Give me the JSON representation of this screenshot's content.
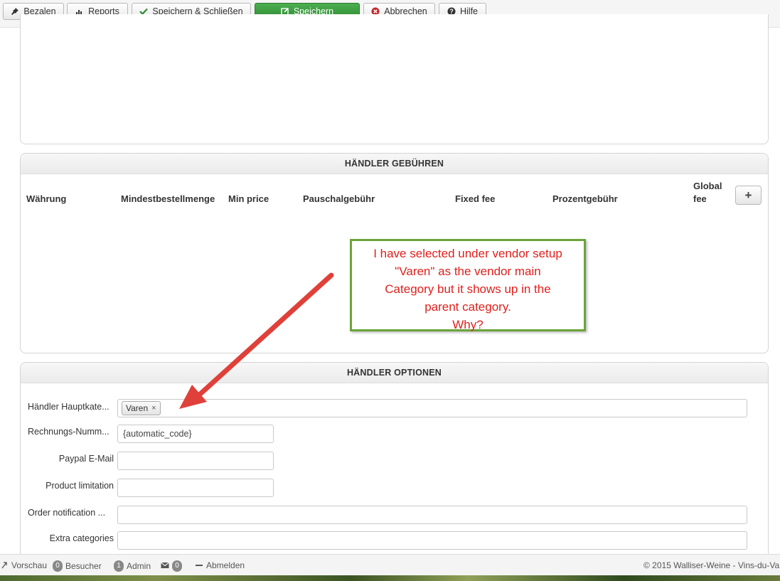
{
  "toolbar": {
    "buttons": [
      {
        "label": "Bezalen",
        "icon": "pin-icon"
      },
      {
        "label": "Reports",
        "icon": "bar-chart-icon"
      },
      {
        "label": "Speichern & Schließen",
        "icon": "check-icon"
      },
      {
        "label": "Speichern",
        "icon": "edit-icon"
      },
      {
        "label": "Abbrechen",
        "icon": "cancel-icon"
      },
      {
        "label": "Hilfe",
        "icon": "question-icon"
      }
    ]
  },
  "fees": {
    "title": "HÄNDLER GEBÜHREN",
    "columns": [
      "Währung",
      "Mindestbestellmenge",
      "Min price",
      "Pauschalgebühr",
      "Fixed fee",
      "Prozentgebühr",
      "Global",
      "fee"
    ],
    "add_label": "+"
  },
  "annotation": {
    "lines": [
      "I have selected under vendor setup",
      "\"Varen\" as the vendor main",
      "Category but it shows up in the",
      "parent category.",
      "Why?"
    ],
    "text_color": "#e0201c",
    "border_color": "#6aa43b"
  },
  "options": {
    "title": "HÄNDLER OPTIONEN",
    "fields": [
      {
        "label": "Händler Hauptkate...",
        "value": "Varen"
      },
      {
        "label": "Rechnungs-Numm...",
        "value": "{automatic_code}"
      },
      {
        "label": "Paypal E-Mail",
        "value": ""
      },
      {
        "label": "Product limitation",
        "value": ""
      },
      {
        "label": "Order notification ...",
        "value": ""
      },
      {
        "label": "Extra categories",
        "value": ""
      }
    ],
    "chip_remove": "×"
  },
  "statusbar": {
    "preview": "Vorschau",
    "visitors_count": "0",
    "visitors_label": "Besucher",
    "admin_count": "1",
    "admin_label": "Admin",
    "messages_count": "0",
    "logout": "Abmelden",
    "copyright": "© 2015 Walliser-Weine - Vins-du-Va"
  },
  "colors": {
    "primary_button": "#2e8b32",
    "annotation_arrow": "#e0403a"
  }
}
